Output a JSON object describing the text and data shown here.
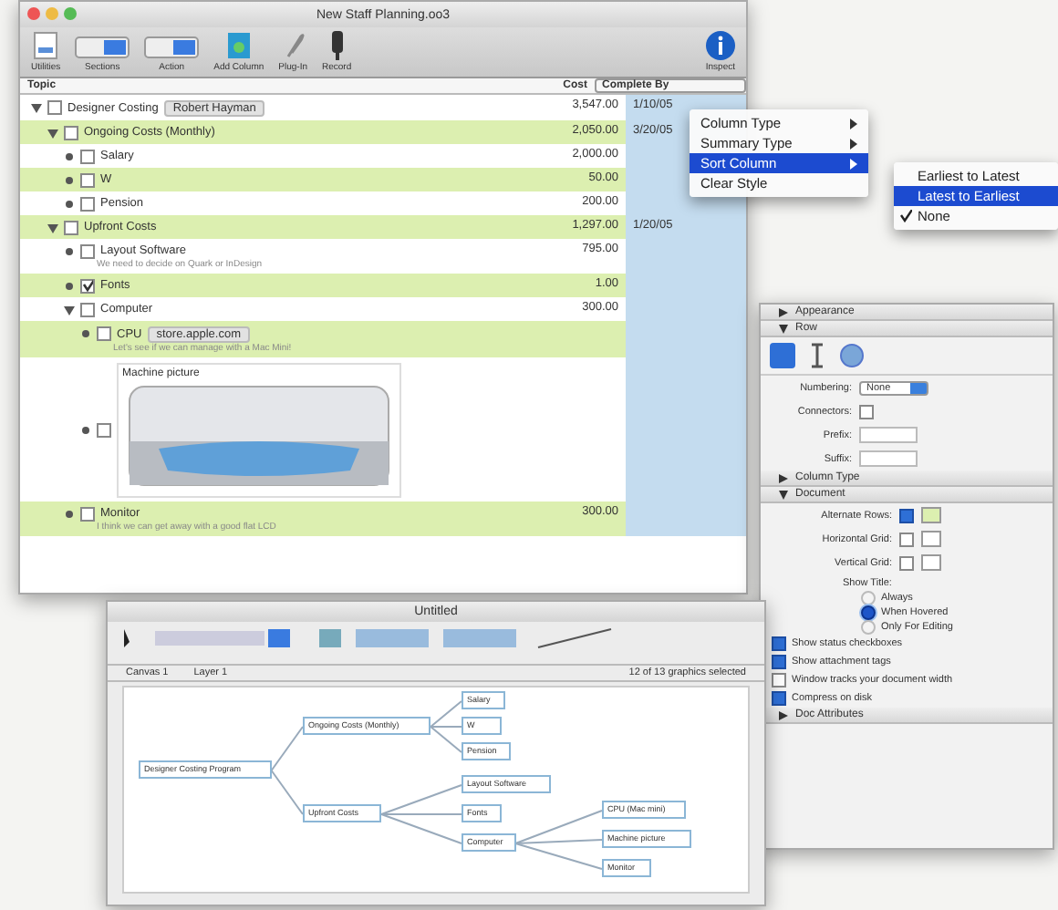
{
  "outline_window": {
    "title": "New Staff Planning.oo3",
    "toolbar": [
      {
        "label": "Utilities",
        "kind": "doc"
      },
      {
        "label": "Sections",
        "kind": "seg"
      },
      {
        "label": "Action",
        "kind": "seg"
      },
      {
        "label": "Add Column",
        "kind": "add"
      },
      {
        "label": "Plug-In",
        "kind": "clip"
      },
      {
        "label": "Record",
        "kind": "rec"
      },
      {
        "label": "Inspect",
        "kind": "info"
      }
    ],
    "columns": [
      {
        "label": "Topic",
        "selected": false
      },
      {
        "label": "Cost",
        "selected": false
      },
      {
        "label": "Complete By",
        "selected": true
      }
    ],
    "rows": [
      {
        "kind": "item",
        "topic": "Designer Costing",
        "tag": "Robert Hayman",
        "cost": "3,547.00",
        "date": "1/10/05",
        "checked": false,
        "children": [
          {
            "kind": "item",
            "topic": "Ongoing Costs (Monthly)",
            "cost": "2,050.00",
            "date": "3/20/05",
            "checked": false,
            "children": [
              {
                "kind": "item",
                "topic": "Salary",
                "cost": "2,000.00",
                "checked": false
              },
              {
                "kind": "item",
                "topic": "W",
                "cost": "50.00",
                "checked": false
              },
              {
                "kind": "item",
                "topic": "Pension",
                "cost": "200.00",
                "checked": false
              }
            ]
          },
          {
            "kind": "item",
            "topic": "Upfront Costs",
            "cost": "1,297.00",
            "date": "1/20/05",
            "checked": false,
            "children": [
              {
                "kind": "item",
                "topic": "Layout Software",
                "cost": "795.00",
                "note": "We need to decide on Quark or InDesign",
                "checked": false
              },
              {
                "kind": "item",
                "topic": "Fonts",
                "cost": "1.00",
                "checked": true
              },
              {
                "kind": "item",
                "topic": "Computer",
                "cost": "300.00",
                "checked": false,
                "children": [
                  {
                    "kind": "item",
                    "topic": "CPU",
                    "tag": "store.apple.com",
                    "note": "Let's see if we can manage with a Mac Mini!",
                    "checked": false
                  },
                  {
                    "kind": "image",
                    "caption": "Machine picture",
                    "checked": false
                  }
                ]
              },
              {
                "kind": "item",
                "topic": "Monitor",
                "cost": "300.00",
                "note": "I think we can get away with a good flat LCD",
                "checked": false
              }
            ]
          }
        ]
      }
    ]
  },
  "context_menu": [
    {
      "label": "Column Type",
      "submenu": true,
      "selected": false
    },
    {
      "label": "Summary Type",
      "submenu": true,
      "selected": false
    },
    {
      "label": "Sort Column",
      "submenu": true,
      "selected": true
    },
    {
      "label": "Clear Style",
      "submenu": false,
      "selected": false
    }
  ],
  "submenu": [
    {
      "label": "Earliest to Latest",
      "selected": false,
      "checked": false
    },
    {
      "label": "Latest to Earliest",
      "selected": true,
      "checked": false
    },
    {
      "label": "None",
      "selected": false,
      "checked": true
    }
  ],
  "inspector": {
    "sections_top": [
      {
        "label": "Appearance",
        "expanded": false
      },
      {
        "label": "Row",
        "expanded": true
      }
    ],
    "fields": [
      {
        "label": "Numbering:",
        "kind": "select",
        "value": "None"
      },
      {
        "label": "Connectors:",
        "kind": "check",
        "checked": false
      },
      {
        "label": "Prefix:",
        "kind": "text"
      },
      {
        "label": "Suffix:",
        "kind": "text"
      }
    ],
    "sections_mid": [
      {
        "label": "Column Type",
        "expanded": false
      },
      {
        "label": "Document",
        "expanded": true
      }
    ],
    "grid": [
      {
        "label": "Alternate Rows:",
        "checked": true
      },
      {
        "label": "Horizontal Grid:",
        "checked": false
      },
      {
        "label": "Vertical Grid:",
        "checked": false
      }
    ],
    "show_title": "Show Title:",
    "radios": [
      {
        "label": "Always",
        "selected": false
      },
      {
        "label": "When Hovered",
        "selected": true
      },
      {
        "label": "Only For Editing",
        "selected": false
      }
    ],
    "checks": [
      {
        "label": "Show status checkboxes",
        "checked": true
      },
      {
        "label": "Show attachment tags",
        "checked": true
      },
      {
        "label": "Window tracks your document width",
        "checked": false
      },
      {
        "label": "Compress on disk",
        "checked": true
      }
    ],
    "sections_bottom": [
      {
        "label": "Doc Attributes",
        "expanded": false
      }
    ]
  },
  "diagram_window": {
    "title": "Untitled",
    "canvas": "Canvas 1",
    "layer": "Layer 1",
    "status": "12 of 13 graphics selected",
    "nodes": [
      "Designer Costing Program",
      "Ongoing Costs (Monthly)",
      "Salary",
      "W",
      "Pension",
      "Upfront Costs",
      "Layout Software",
      "Fonts",
      "Computer",
      "CPU (Mac mini)",
      "Machine picture",
      "Monitor"
    ]
  }
}
